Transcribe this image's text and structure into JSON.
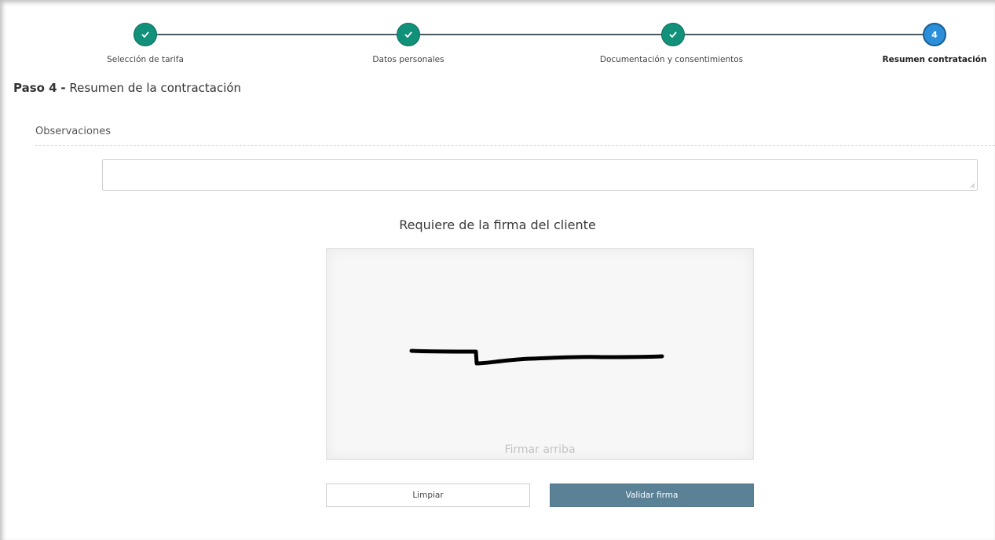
{
  "stepper": {
    "steps": [
      {
        "label": "Selección de tarifa",
        "state": "done",
        "icon": "check-icon"
      },
      {
        "label": "Datos personales",
        "state": "done",
        "icon": "check-icon"
      },
      {
        "label": "Documentación y consentimientos",
        "state": "done",
        "icon": "check-icon"
      },
      {
        "label": "Resumen contratación",
        "state": "active",
        "number": "4"
      }
    ]
  },
  "header": {
    "step_prefix": "Paso 4",
    "separator": "-",
    "title": "Resumen de la contractación"
  },
  "observations": {
    "label": "Observaciones",
    "value": ""
  },
  "signature": {
    "heading": "Requiere de la firma del cliente",
    "hint": "Firmar arriba"
  },
  "buttons": {
    "clear_label": "Limpiar",
    "validate_label": "Validar firma"
  },
  "colors": {
    "done": "#12917a",
    "active": "#2a8fd8",
    "primary_button": "#5b8196"
  }
}
